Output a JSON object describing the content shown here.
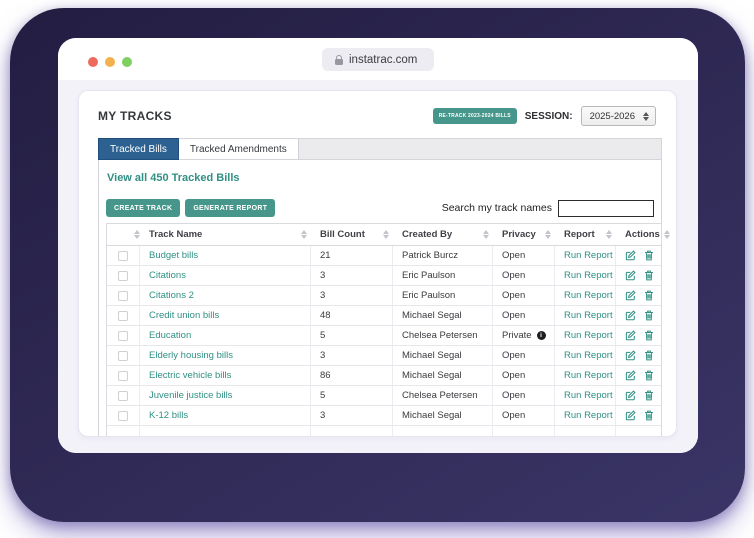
{
  "browser": {
    "url": "instatrac.com",
    "traffic_lights": [
      "#ee6a5f",
      "#f3b04e",
      "#7fd15f"
    ]
  },
  "page": {
    "title": "MY TRACKS",
    "retrack_button_label": "RE-TRACK 2023-2024 BILLS",
    "session_label": "SESSION:",
    "session_value": "2025-2026",
    "tabs": [
      {
        "label": "Tracked Bills",
        "active": true
      },
      {
        "label": "Tracked Amendments",
        "active": false
      }
    ],
    "view_all_link": "View all 450 Tracked Bills",
    "toolbar": {
      "create_track_label": "CREATE TRACK",
      "generate_report_label": "GENERATE REPORT",
      "search_label": "Search my track names",
      "search_value": ""
    }
  },
  "table": {
    "headers": [
      "",
      "Track Name",
      "Bill Count",
      "Created By",
      "Privacy",
      "Report",
      "Actions"
    ],
    "run_report_label": "Run Report",
    "rows": [
      {
        "name": "Budget bills",
        "count": "21",
        "created_by": "Patrick Burcz",
        "privacy": "Open",
        "private_info": false
      },
      {
        "name": "Citations",
        "count": "3",
        "created_by": "Eric Paulson",
        "privacy": "Open",
        "private_info": false
      },
      {
        "name": "Citations 2",
        "count": "3",
        "created_by": "Eric Paulson",
        "privacy": "Open",
        "private_info": false
      },
      {
        "name": "Credit union bills",
        "count": "48",
        "created_by": "Michael Segal",
        "privacy": "Open",
        "private_info": false
      },
      {
        "name": "Education",
        "count": "5",
        "created_by": "Chelsea Petersen",
        "privacy": "Private",
        "private_info": true
      },
      {
        "name": "Elderly housing bills",
        "count": "3",
        "created_by": "Michael Segal",
        "privacy": "Open",
        "private_info": false
      },
      {
        "name": "Electric vehicle bills",
        "count": "86",
        "created_by": "Michael Segal",
        "privacy": "Open",
        "private_info": false
      },
      {
        "name": "Juvenile justice bills",
        "count": "5",
        "created_by": "Chelsea Petersen",
        "privacy": "Open",
        "private_info": false
      },
      {
        "name": "K-12 bills",
        "count": "3",
        "created_by": "Michael Segal",
        "privacy": "Open",
        "private_info": false
      }
    ]
  },
  "colors": {
    "teal_button": "#46968b",
    "teal_link": "#2f9083",
    "tab_active": "#2c6191",
    "frame_a": "#231d42",
    "frame_b": "#3a3566",
    "glow": "rgba(126,110,195,0.5)",
    "window_bg": "#f3f2f9"
  }
}
